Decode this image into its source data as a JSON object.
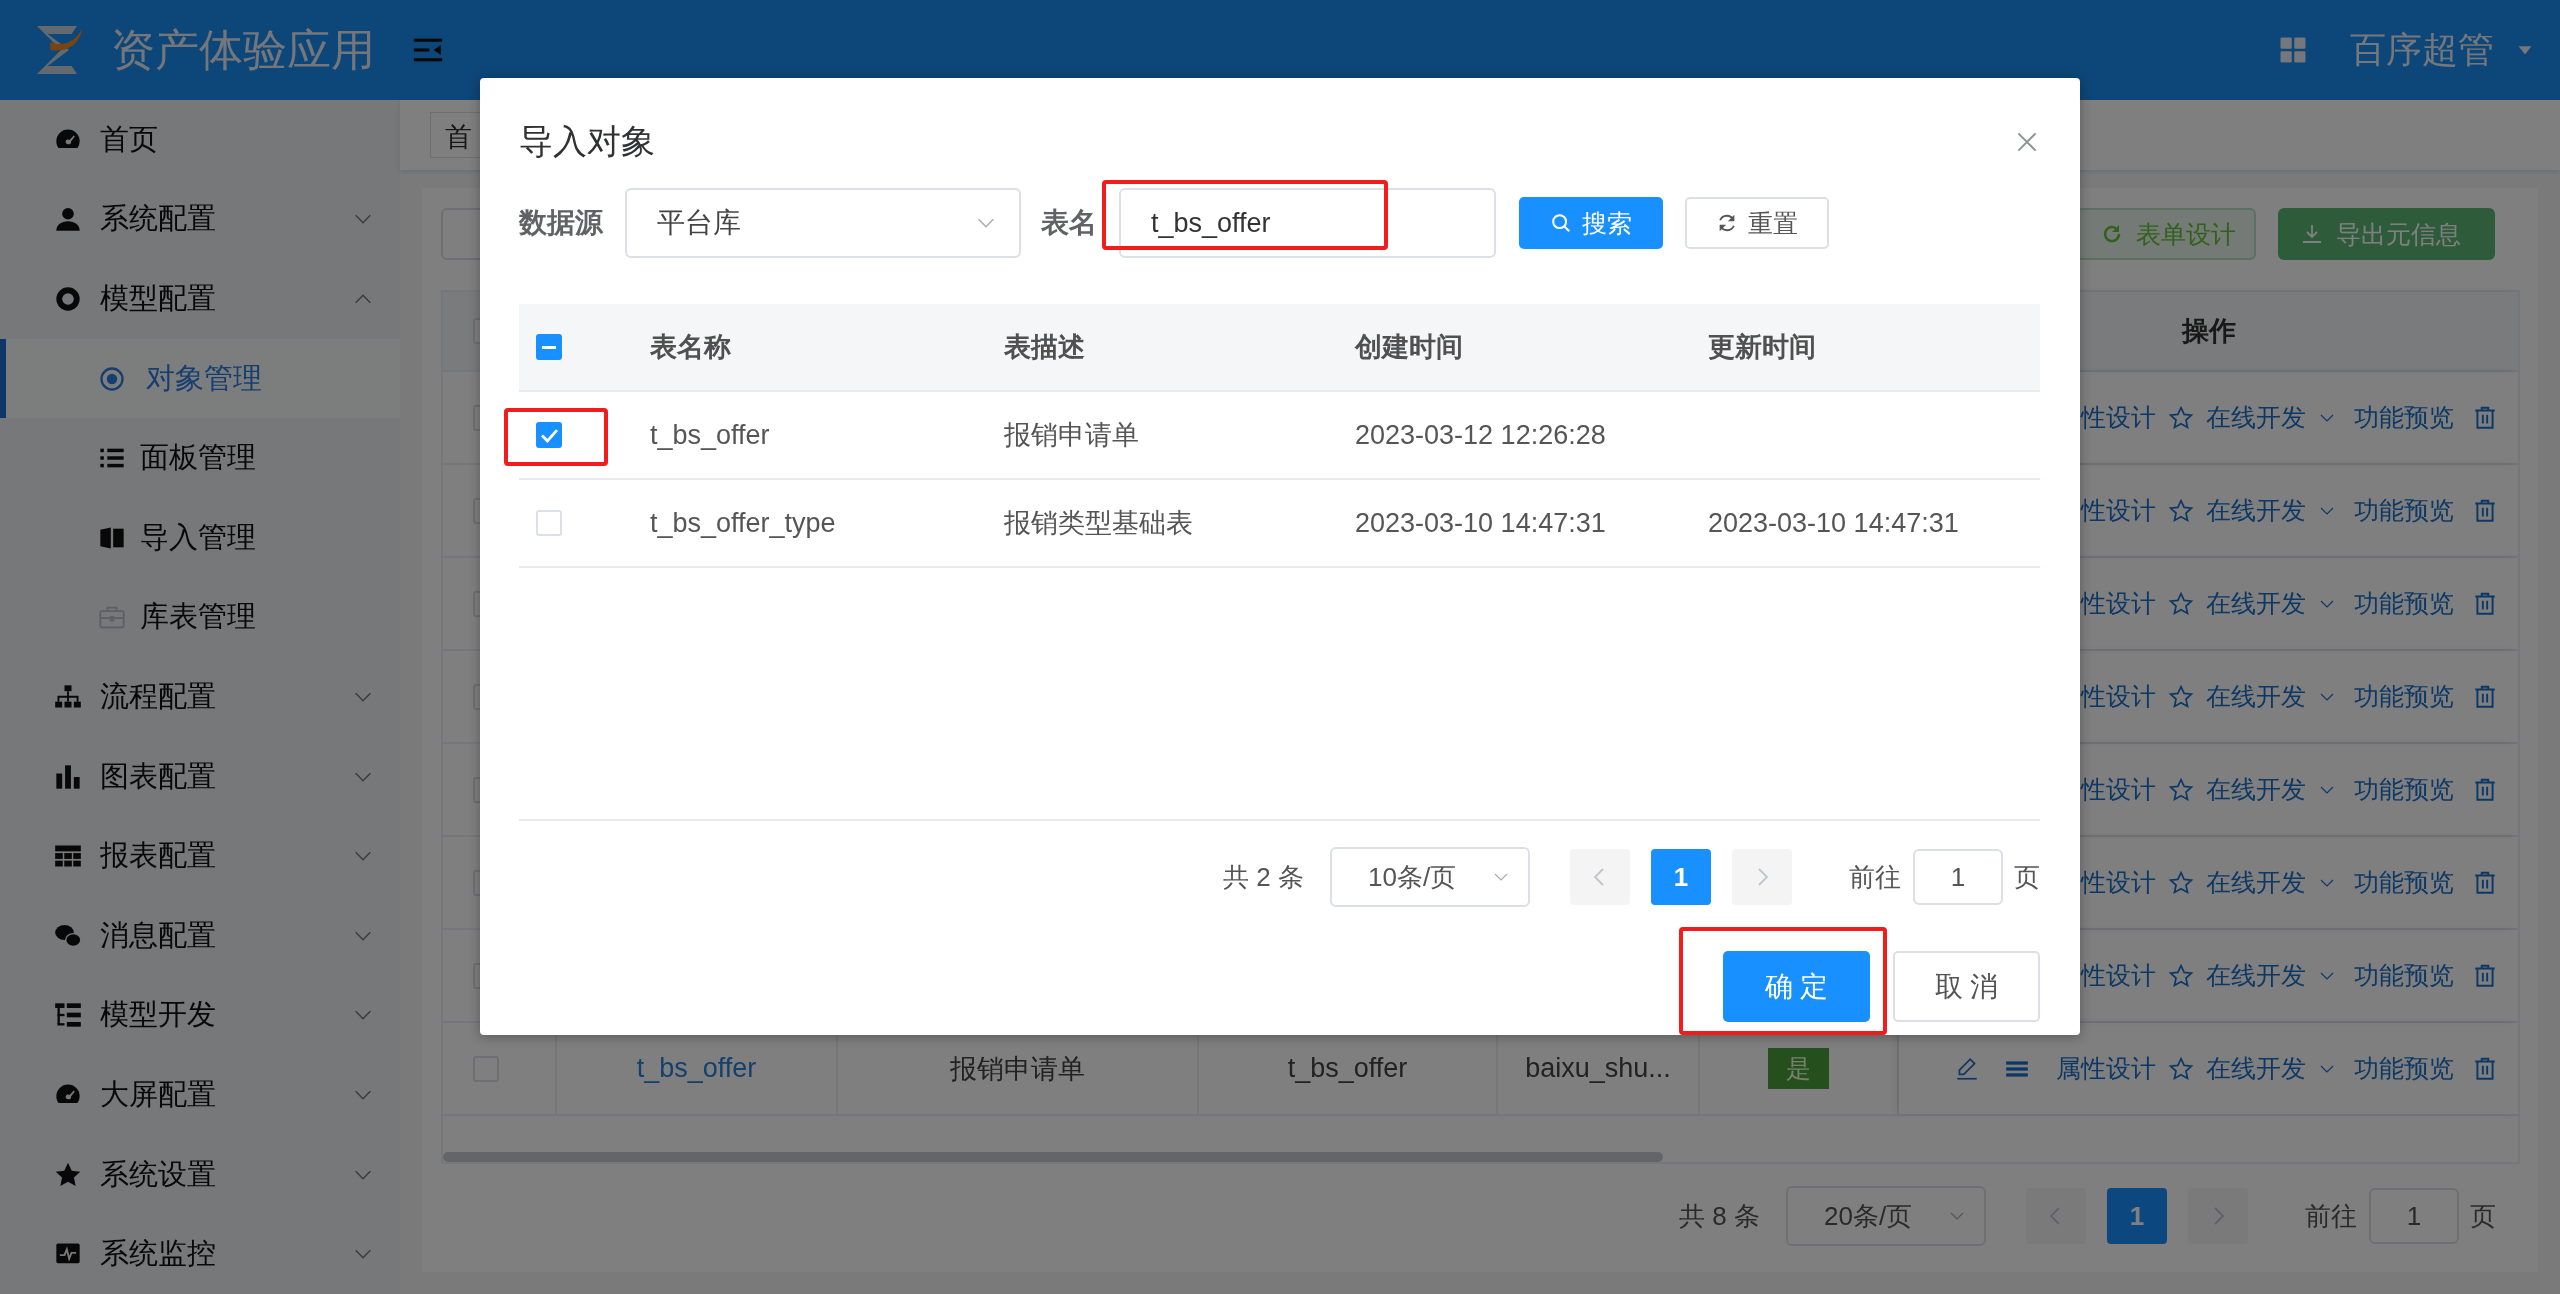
{
  "header": {
    "app_title": "资产体验应用",
    "user_name": "百序超管"
  },
  "sidebar": {
    "items": [
      {
        "label": "首页",
        "selected": false
      },
      {
        "label": "系统配置",
        "selected": false,
        "expanded": false
      },
      {
        "label": "模型配置",
        "selected": false,
        "expanded": true,
        "children": [
          {
            "label": "对象管理",
            "selected": true,
            "disabled": false
          },
          {
            "label": "面板管理",
            "selected": false,
            "disabled": false
          },
          {
            "label": "导入管理",
            "selected": false,
            "disabled": false
          },
          {
            "label": "库表管理",
            "selected": false,
            "disabled": true
          }
        ]
      },
      {
        "label": "流程配置",
        "selected": false,
        "expanded": false
      },
      {
        "label": "图表配置",
        "selected": false,
        "expanded": false
      },
      {
        "label": "报表配置",
        "selected": false,
        "expanded": false
      },
      {
        "label": "消息配置",
        "selected": false,
        "expanded": false
      },
      {
        "label": "模型开发",
        "selected": false,
        "expanded": false
      },
      {
        "label": "大屏配置",
        "selected": false,
        "expanded": false
      },
      {
        "label": "系统设置",
        "selected": false,
        "expanded": false
      },
      {
        "label": "系统监控",
        "selected": false,
        "expanded": false
      }
    ]
  },
  "tag_bar": {
    "tags": [
      "首"
    ]
  },
  "toolbar": {
    "buttons": [
      {
        "kind": "default"
      },
      {
        "kind": "plain",
        "label": "表单设计"
      },
      {
        "kind": "solid",
        "label": "导出元信息"
      }
    ]
  },
  "table": {
    "action_header": "操作",
    "header_checked": false,
    "rows": [
      {
        "checked": false,
        "actions": [
          "性设计",
          "在线开发",
          "功能预览"
        ]
      },
      {
        "checked": false,
        "actions": [
          "性设计",
          "在线开发",
          "功能预览"
        ]
      },
      {
        "checked": false,
        "actions": [
          "性设计",
          "在线开发",
          "功能预览"
        ]
      },
      {
        "checked": false,
        "actions": [
          "性设计",
          "在线开发",
          "功能预览"
        ]
      },
      {
        "checked": false,
        "actions": [
          "性设计",
          "在线开发",
          "功能预览"
        ]
      },
      {
        "checked": false,
        "actions": [
          "性设计",
          "在线开发",
          "功能预览"
        ]
      },
      {
        "checked": false,
        "actions": [
          "性设计",
          "在线开发",
          "功能预览"
        ]
      },
      {
        "checked": false,
        "name": "t_bs_offer",
        "description": "报销申请单",
        "table_name": "t_bs_offer",
        "creator": "baixu_shu...",
        "flag": "是",
        "actions": [
          "属性设计",
          "在线开发",
          "功能预览"
        ]
      }
    ]
  },
  "pagination": {
    "total": "共 8 条",
    "page_size": "20条/页",
    "pages": [
      {
        "label": "1",
        "selected": true
      }
    ],
    "goto_label": "前往",
    "goto_value": "1",
    "page_unit": "页"
  },
  "dialog": {
    "title": "导入对象",
    "filters": {
      "source_label": "数据源",
      "source_value": "平台库",
      "table_label": "表名",
      "table_value": "t_bs_offer",
      "table_highlighted": true
    },
    "search_button": "搜索",
    "reset_button": "重置",
    "table": {
      "header_checked": true,
      "header_indeterminate": true,
      "columns": [
        "表名称",
        "表描述",
        "创建时间",
        "更新时间"
      ],
      "rows": [
        {
          "checked": true,
          "highlighted": true,
          "cells": [
            "t_bs_offer",
            "报销申请单",
            "2023-03-12 12:26:28"
          ]
        },
        {
          "checked": false,
          "highlighted": false,
          "cells": [
            "t_bs_offer_type",
            "报销类型基础表",
            "2023-03-10 14:47:31",
            "2023-03-10 14:47:31"
          ]
        }
      ]
    },
    "pagination": {
      "total": "共 2 条",
      "page_size": "10条/页",
      "pages": [
        {
          "label": "1",
          "selected": true
        }
      ],
      "goto_label": "前往",
      "goto_value": "1",
      "page_unit": "页"
    },
    "buttons": [
      {
        "kind": "primary",
        "label": "确 定",
        "highlighted": true
      },
      {
        "kind": "default",
        "label": "取 消",
        "highlighted": false
      }
    ]
  }
}
